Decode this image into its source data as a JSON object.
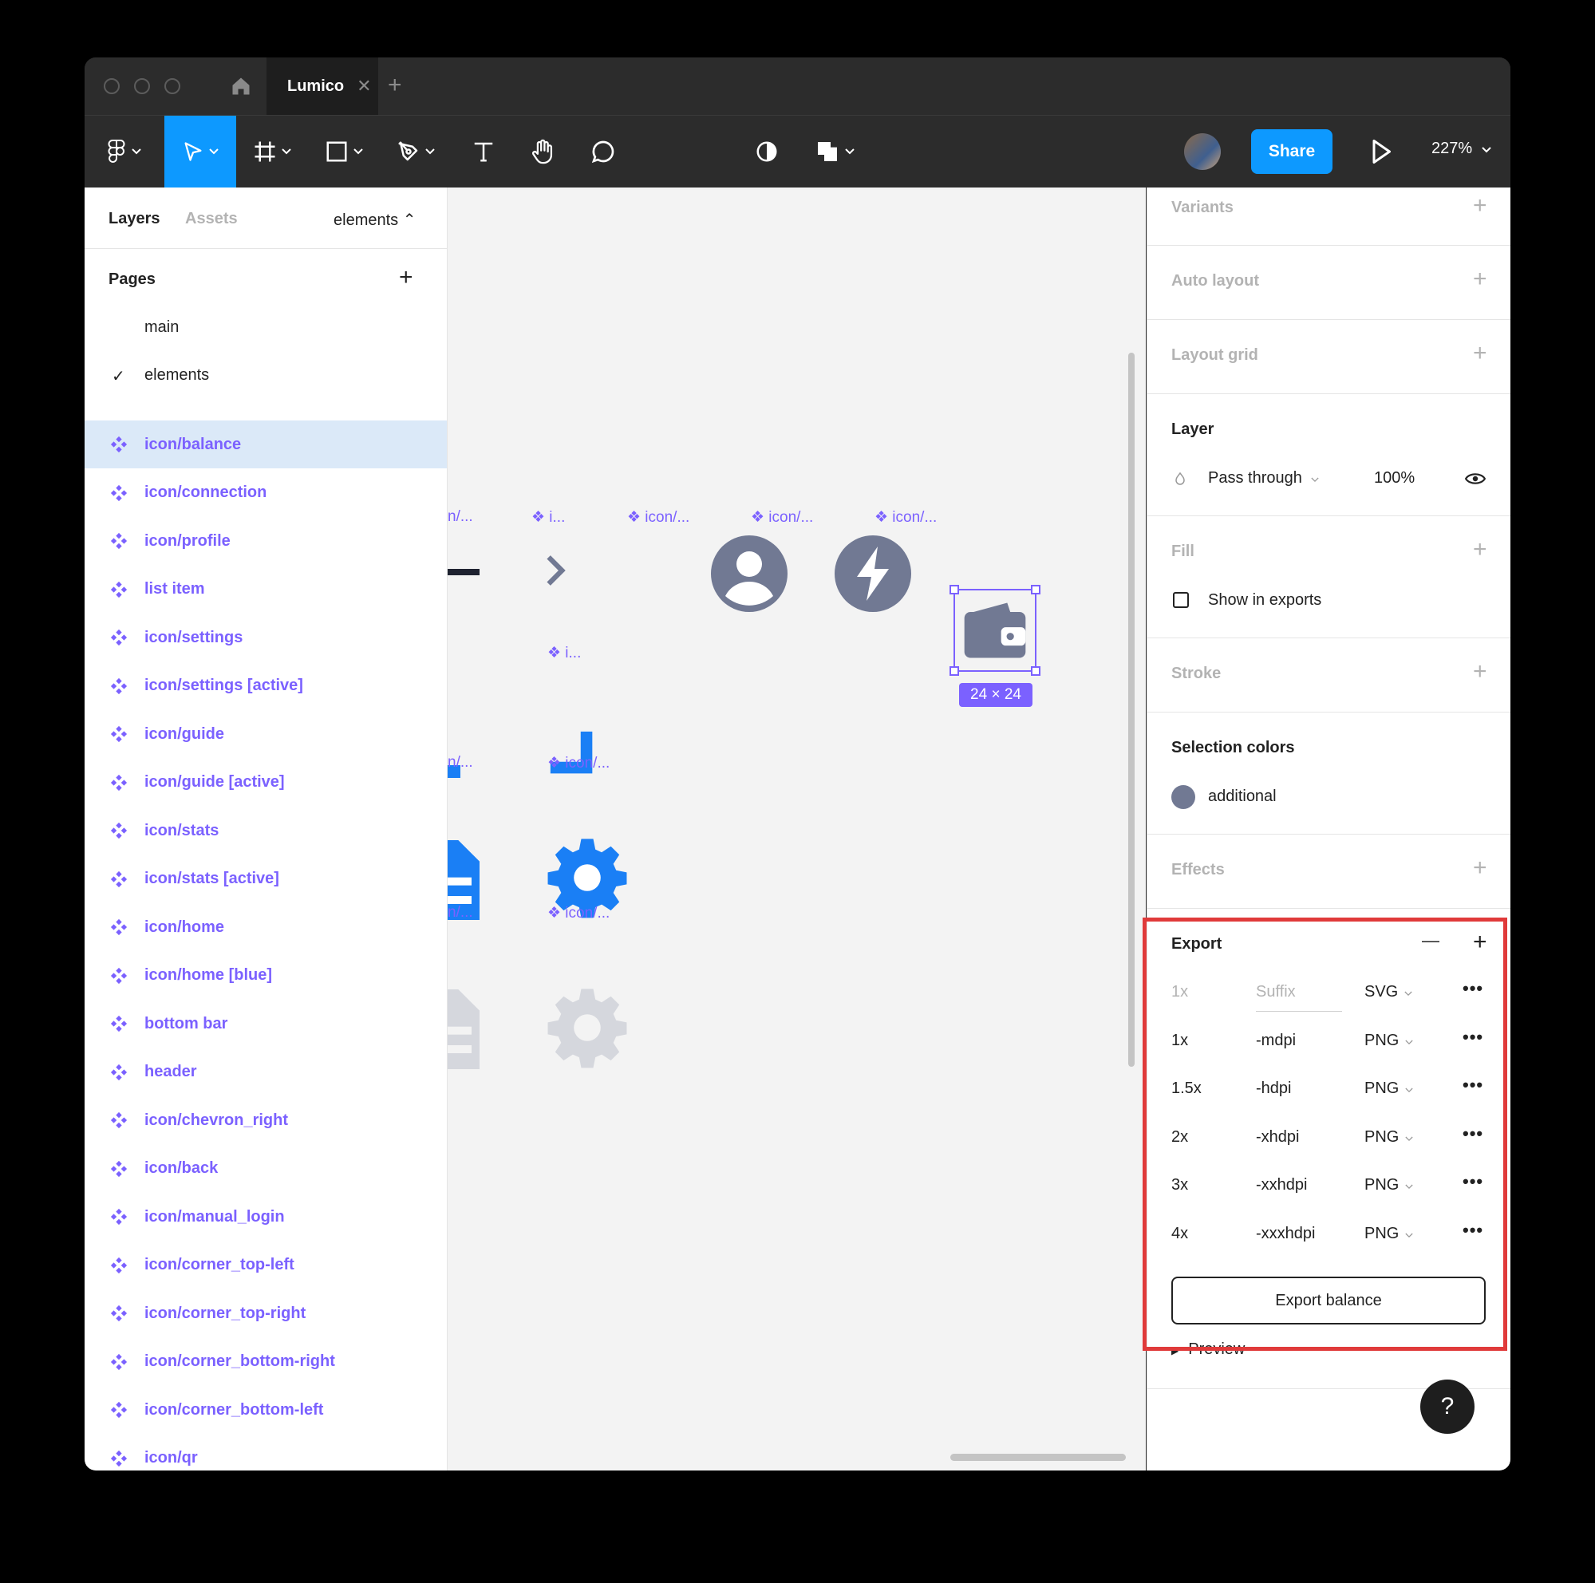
{
  "titlebar": {
    "tab_label": "Lumico",
    "tab_close": "✕",
    "new_tab": "+"
  },
  "toolbar": {
    "share_label": "Share",
    "zoom": "227%"
  },
  "left_panel": {
    "tab_layers": "Layers",
    "tab_assets": "Assets",
    "page_selector": "elements ⌃",
    "pages_title": "Pages",
    "pages_add": "+",
    "pages": [
      "main",
      "elements"
    ],
    "active_check": "✓",
    "layers": [
      "icon/balance",
      "icon/connection",
      "icon/profile",
      "list item",
      "icon/settings",
      "icon/settings [active]",
      "icon/guide",
      "icon/guide [active]",
      "icon/stats",
      "icon/stats [active]",
      "icon/home",
      "icon/home [blue]",
      "bottom bar",
      "header",
      "icon/chevron_right",
      "icon/back",
      "icon/manual_login",
      "icon/corner_top-left",
      "icon/corner_top-right",
      "icon/corner_bottom-right",
      "icon/corner_bottom-left",
      "icon/qr"
    ]
  },
  "canvas": {
    "labels": [
      "n/...",
      "❖ i...",
      "❖ icon/...",
      "❖ icon/...",
      "❖ icon/...",
      "❖ i...",
      "n/...",
      "❖ icon/...",
      "n/...",
      "❖ icon/..."
    ],
    "size_badge": "24 × 24",
    "colors": {
      "icon_gray": "#717993",
      "icon_blue": "#1a7ff5",
      "icon_light": "#d5d7dd",
      "selection": "#7b61ff"
    }
  },
  "right_panel": {
    "variants": "Variants",
    "auto_layout": "Auto layout",
    "layout_grid": "Layout grid",
    "layer_title": "Layer",
    "blend_mode": "Pass through",
    "opacity": "100%",
    "fill_title": "Fill",
    "show_in_exports": "Show in exports",
    "stroke_title": "Stroke",
    "selection_colors_title": "Selection colors",
    "selection_color_name": "additional",
    "effects_title": "Effects",
    "export_title": "Export",
    "export_rows": [
      {
        "scale": "1x",
        "suffix": "Suffix",
        "format": "SVG"
      },
      {
        "scale": "1x",
        "suffix": "-mdpi",
        "format": "PNG"
      },
      {
        "scale": "1.5x",
        "suffix": "-hdpi",
        "format": "PNG"
      },
      {
        "scale": "2x",
        "suffix": "-xhdpi",
        "format": "PNG"
      },
      {
        "scale": "3x",
        "suffix": "-xxhdpi",
        "format": "PNG"
      },
      {
        "scale": "4x",
        "suffix": "-xxxhdpi",
        "format": "PNG"
      }
    ],
    "export_button": "Export balance",
    "preview": "Preview",
    "plus": "+",
    "minus": "—",
    "more": "•••"
  },
  "help_button": "?"
}
